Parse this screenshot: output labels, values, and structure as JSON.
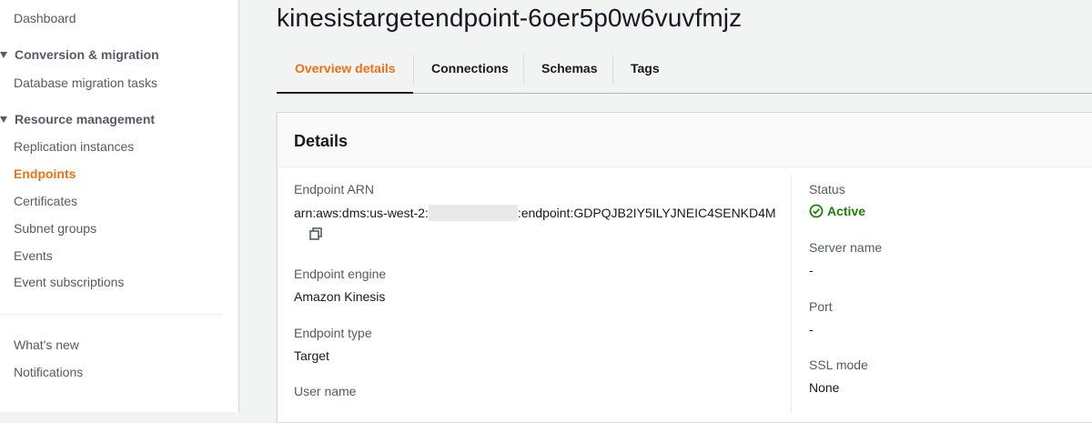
{
  "sidebar": {
    "items_top": [
      {
        "label": "Dashboard"
      }
    ],
    "sections": [
      {
        "label": "Conversion & migration"
      },
      {
        "label": "Resource management"
      }
    ],
    "conversion_items": [
      {
        "label": "Database migration tasks"
      }
    ],
    "resource_items": [
      {
        "label": "Replication instances"
      },
      {
        "label": "Endpoints",
        "active": true
      },
      {
        "label": "Certificates"
      },
      {
        "label": "Subnet groups"
      },
      {
        "label": "Events"
      },
      {
        "label": "Event subscriptions"
      }
    ],
    "footer_items": [
      {
        "label": "What's new"
      },
      {
        "label": "Notifications"
      }
    ]
  },
  "page": {
    "title": "kinesistargetendpoint-6oer5p0w6vuvfmjz"
  },
  "tabs": [
    {
      "label": "Overview details",
      "active": true
    },
    {
      "label": "Connections"
    },
    {
      "label": "Schemas"
    },
    {
      "label": "Tags"
    }
  ],
  "details": {
    "title": "Details",
    "left": {
      "arn_label": "Endpoint ARN",
      "arn_prefix": "arn:aws:dms:us-west-2:",
      "arn_suffix": ":endpoint:GDPQJB2IY5ILYJNEIC4SENKD4M",
      "engine_label": "Endpoint engine",
      "engine_value": "Amazon Kinesis",
      "type_label": "Endpoint type",
      "type_value": "Target",
      "username_label": "User name"
    },
    "right": {
      "status_label": "Status",
      "status_value": "Active",
      "server_label": "Server name",
      "server_value": "-",
      "port_label": "Port",
      "port_value": "-",
      "ssl_label": "SSL mode",
      "ssl_value": "None"
    }
  },
  "icons": {
    "copy": "copy-icon",
    "status": "check-circle-icon",
    "caret": "caret-down-icon"
  },
  "colors": {
    "accent": "#ec7211",
    "success": "#1d8102",
    "text": "#16191f",
    "muted": "#545b64"
  }
}
